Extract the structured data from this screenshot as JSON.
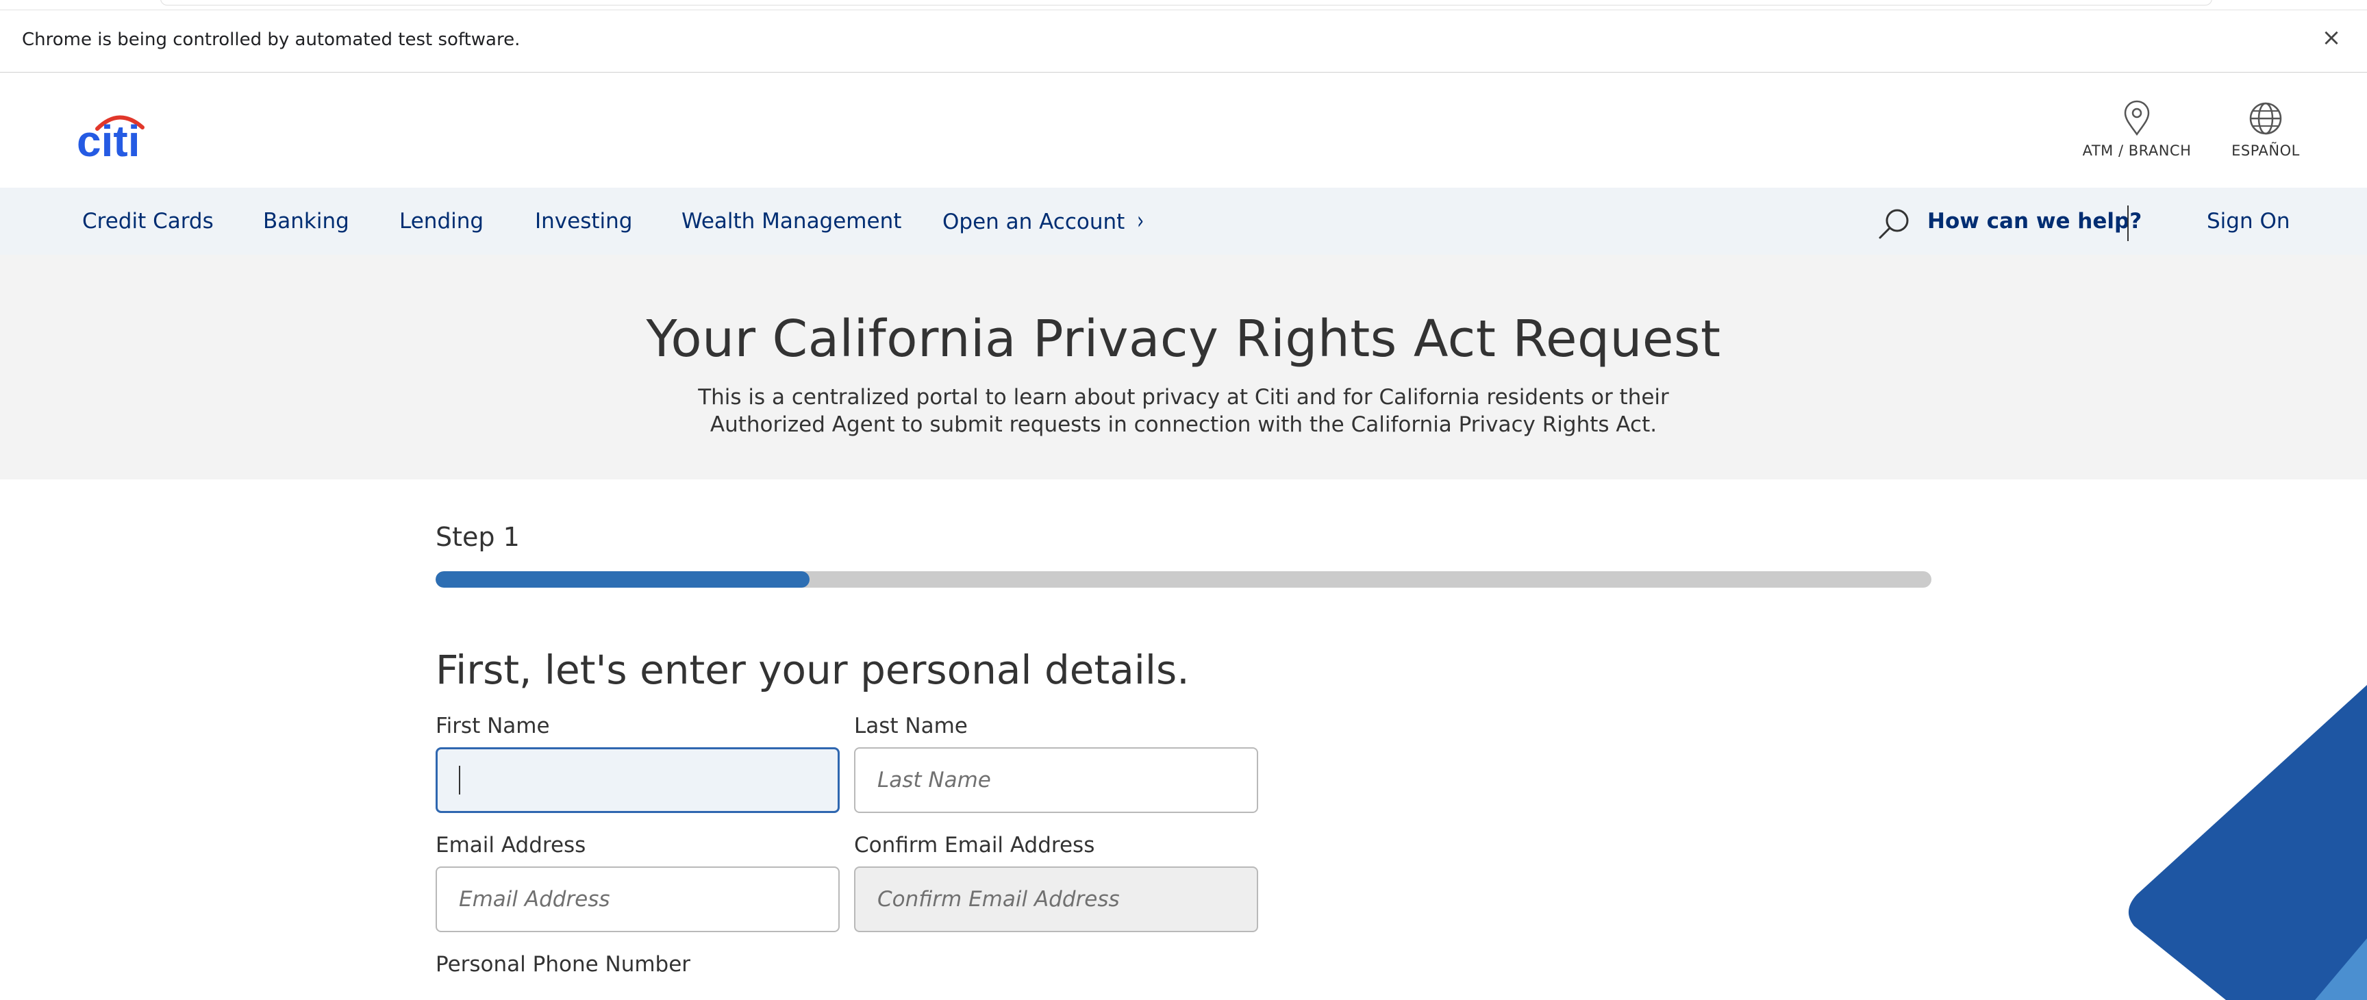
{
  "browser": {
    "infobar_message": "Chrome is being controlled by automated test software.",
    "infobar_close": "×"
  },
  "header": {
    "logo_text": "citi",
    "utilities": [
      {
        "label": "ATM / BRANCH",
        "icon": "map-pin-icon"
      },
      {
        "label": "ESPAÑOL",
        "icon": "globe-icon"
      }
    ]
  },
  "nav": {
    "items": [
      "Credit Cards",
      "Banking",
      "Lending",
      "Investing",
      "Wealth Management",
      "Open an Account"
    ],
    "open_account_chevron": "›",
    "search_icon": "search-icon",
    "help_label": "How can we help?",
    "sign_on_label": "Sign On"
  },
  "hero": {
    "title": "Your California Privacy Rights Act Request",
    "subtitle_line1": "This is a centralized portal to learn about privacy at Citi and for California residents or their",
    "subtitle_line2": "Authorized Agent to submit requests in connection with the California Privacy Rights Act."
  },
  "form": {
    "step_label": "Step 1",
    "progress_fraction": 0.25,
    "heading": "First, let's enter your personal details.",
    "fields": {
      "first_name": {
        "label": "First Name",
        "value": "",
        "placeholder": ""
      },
      "last_name": {
        "label": "Last Name",
        "value": "",
        "placeholder": "Last Name"
      },
      "email": {
        "label": "Email Address",
        "value": "",
        "placeholder": "Email Address"
      },
      "confirm_email": {
        "label": "Confirm Email Address",
        "value": "",
        "placeholder": "Confirm Email Address"
      },
      "phone": {
        "label": "Personal Phone Number"
      }
    }
  },
  "colors": {
    "brand_navy": "#002d72",
    "citi_red": "#e1372a",
    "citi_blue": "#255be3",
    "progress_fill": "#2d6eb3",
    "progress_track": "#cbcbcb",
    "nav_bg": "#eff3f7",
    "hero_bg": "#f3f3f3",
    "focus_border": "#2f67b0",
    "corner_blue": "#1e56a3"
  }
}
